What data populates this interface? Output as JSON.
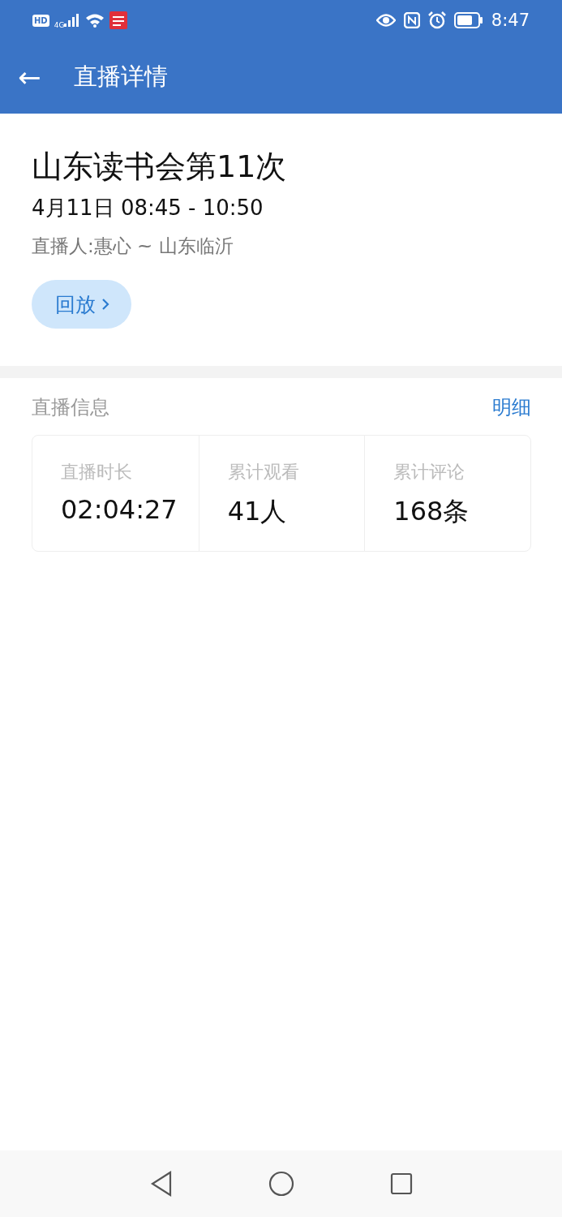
{
  "status_bar": {
    "hd": "HD",
    "network": "4G",
    "time": "8:47"
  },
  "header": {
    "back": "←",
    "title": "直播详情"
  },
  "live": {
    "title": "山东读书会第11次",
    "time": "4月11日 08:45 - 10:50",
    "host": "直播人:惠心 ~ 山东临沂",
    "replay_button": "回放"
  },
  "info": {
    "heading": "直播信息",
    "detail_link": "明细",
    "stats": [
      {
        "label": "直播时长",
        "value": "02:04:27"
      },
      {
        "label": "累计观看",
        "value": "41人"
      },
      {
        "label": "累计评论",
        "value": "168条"
      }
    ]
  }
}
